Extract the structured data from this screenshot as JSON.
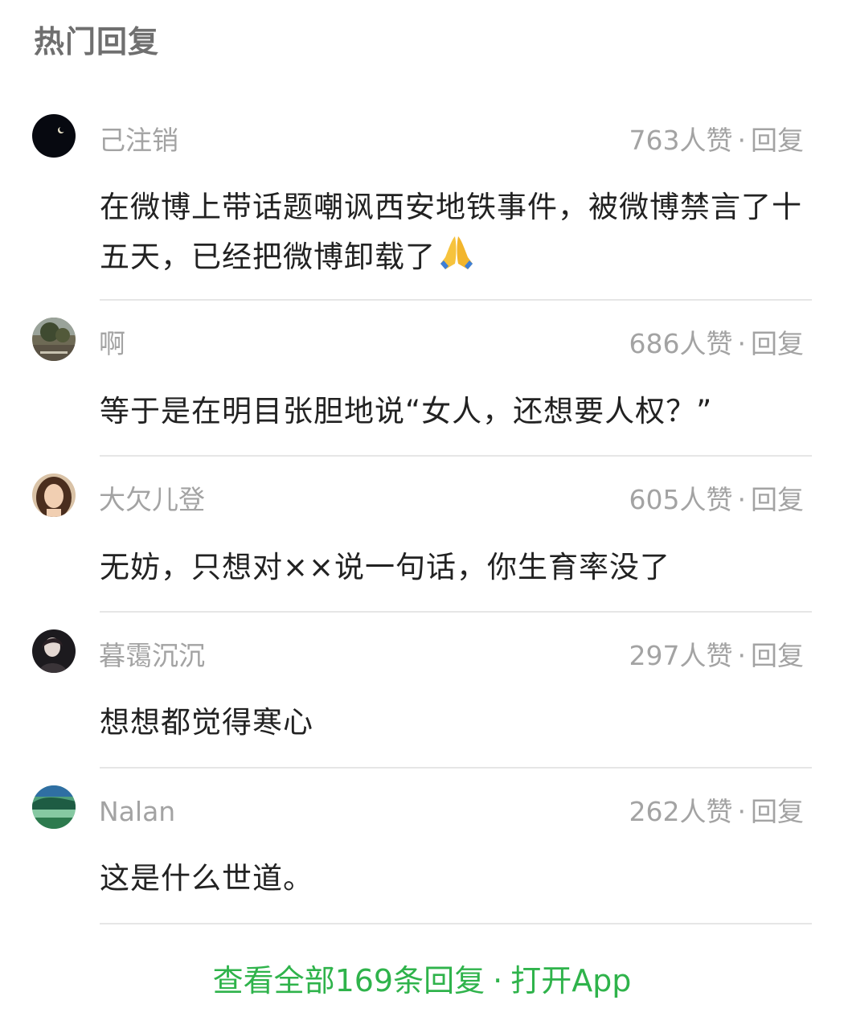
{
  "section_title": "热门回复",
  "comments": [
    {
      "username": "己注销",
      "likes": "763人赞",
      "separator": "·",
      "reply_label": "回复",
      "content": "在微博上带话题嘲讽西安地铁事件，被微博禁言了十五天，已经把微博卸载了",
      "emoji": "folded-hands-icon"
    },
    {
      "username": "啊",
      "likes": "686人赞",
      "separator": "·",
      "reply_label": "回复",
      "content": "等于是在明目张胆地说“女人，还想要人权？”"
    },
    {
      "username": "大欠儿登",
      "likes": "605人赞",
      "separator": "·",
      "reply_label": "回复",
      "content": "无妨，只想对××说一句话，你生育率没了"
    },
    {
      "username": "暮霭沉沉",
      "likes": "297人赞",
      "separator": "·",
      "reply_label": "回复",
      "content": "想想都觉得寒心"
    },
    {
      "username": "Nalan",
      "likes": "262人赞",
      "separator": "·",
      "reply_label": "回复",
      "content": "这是什么世道。"
    }
  ],
  "footer": {
    "view_all": "查看全部169条回复",
    "separator": "·",
    "open_app": "打开App"
  },
  "colors": {
    "accent_green": "#2fb34b",
    "meta_gray": "#a3a3a3",
    "title_gray": "#6f6f6f",
    "divider": "#e6e6e6"
  }
}
